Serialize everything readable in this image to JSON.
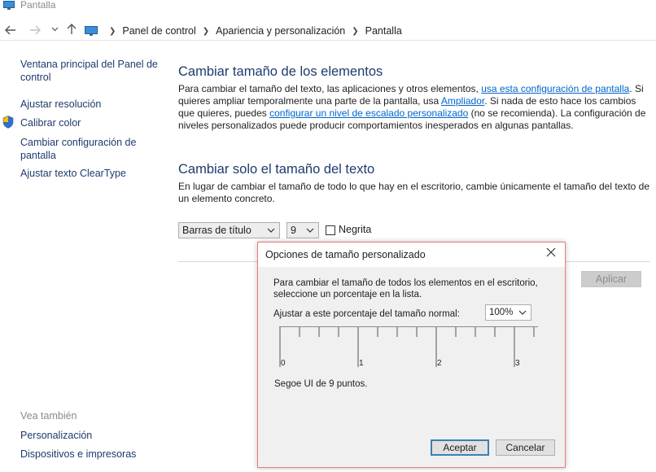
{
  "window": {
    "title": "Pantalla",
    "icon": "monitor-icon"
  },
  "nav": {
    "back_icon": "arrow-left-icon",
    "forward_icon": "arrow-right-icon",
    "recent_icon": "chevron-down-icon",
    "up_icon": "arrow-up-icon",
    "breadcrumbs": [
      "Panel de control",
      "Apariencia y personalización",
      "Pantalla"
    ]
  },
  "sidebar": {
    "items": [
      {
        "label": "Ventana principal del Panel de control"
      },
      {
        "label": "Ajustar resolución"
      },
      {
        "label": "Calibrar color",
        "icon": "shield-icon"
      },
      {
        "label": "Cambiar configuración de pantalla"
      },
      {
        "label": "Ajustar texto ClearType"
      }
    ],
    "see_also_label": "Vea también",
    "see_also": [
      {
        "label": "Personalización"
      },
      {
        "label": "Dispositivos e impresoras"
      }
    ]
  },
  "main": {
    "section1": {
      "heading": "Cambiar tamaño de los elementos",
      "p1": "Para cambiar el tamaño del texto, las aplicaciones y otros elementos, ",
      "link1": "usa esta configuración de pantalla",
      "p2": ". Si quieres ampliar temporalmente una parte de la pantalla, usa ",
      "link2": "Ampliador",
      "p3": ". Si nada de esto hace los cambios que quieres, puedes ",
      "link3": "configurar un nivel de escalado personalizado",
      "p4": " (no se recomienda). La configuración de niveles personalizados puede producir comportamientos inesperados en algunas pantallas."
    },
    "section2": {
      "heading": "Cambiar solo el tamaño del texto",
      "text": "En lugar de cambiar el tamaño de todo lo que hay en el escritorio, cambie únicamente el tamaño del texto de un elemento concreto.",
      "element_select": "Barras de título",
      "size_select": "9",
      "bold_label": "Negrita",
      "bold_checked": false
    },
    "apply_label": "Aplicar"
  },
  "dialog": {
    "title": "Opciones de tamaño personalizado",
    "description": "Para cambiar el tamaño de todos los elementos en el escritorio, seleccione un porcentaje en la lista.",
    "scale_label": "Ajustar a este porcentaje del tamaño normal:",
    "scale_value": "100%",
    "ruler_labels": [
      "0",
      "1",
      "2",
      "3"
    ],
    "font_info": "Segoe UI de 9 puntos.",
    "ok_label": "Aceptar",
    "cancel_label": "Cancelar",
    "close_icon": "close-icon",
    "ruler_icon": "ruler-icon"
  },
  "colors": {
    "link": "#0066cc",
    "heading": "#1e3a6e",
    "dialog_border": "#e87c7c",
    "dialog_bg": "#f0f0f0"
  }
}
